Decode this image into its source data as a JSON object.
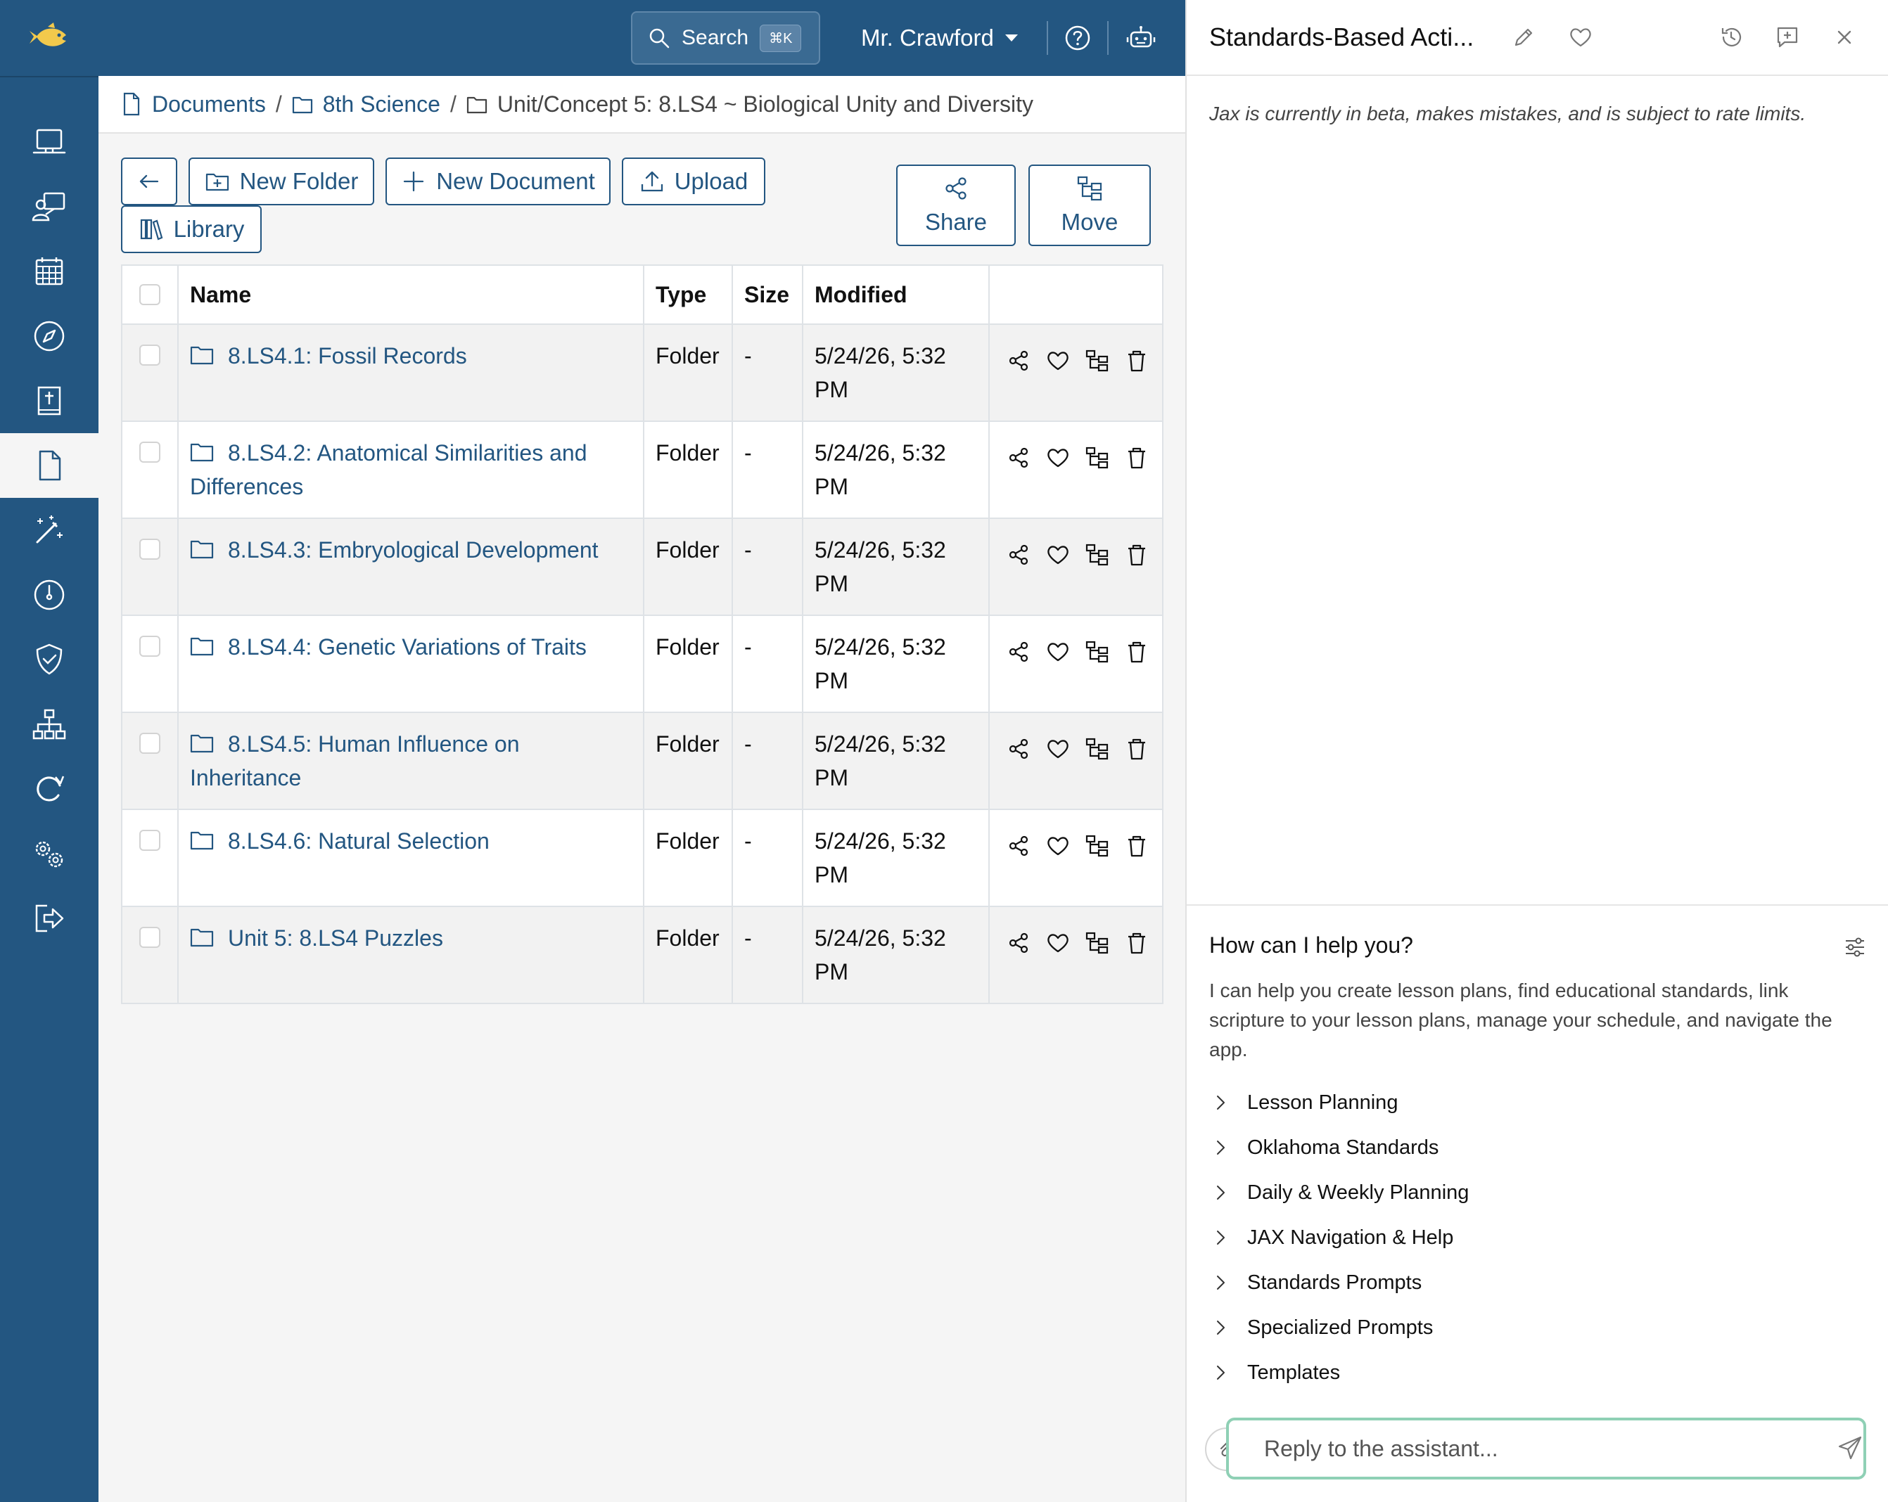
{
  "topbar": {
    "search_label": "Search",
    "search_shortcut": "⌘K",
    "user_name": "Mr. Crawford"
  },
  "sidebar": {
    "items": [
      {
        "icon": "laptop-icon"
      },
      {
        "icon": "teacher-icon"
      },
      {
        "icon": "calendar-icon"
      },
      {
        "icon": "compass-icon"
      },
      {
        "icon": "bible-icon"
      },
      {
        "icon": "document-icon",
        "active": true
      },
      {
        "icon": "magic-wand-icon"
      },
      {
        "icon": "speedometer-icon"
      },
      {
        "icon": "shield-check-icon"
      },
      {
        "icon": "sitemap-icon"
      },
      {
        "icon": "refresh-icon"
      },
      {
        "icon": "gears-icon"
      },
      {
        "icon": "logout-icon"
      }
    ]
  },
  "breadcrumb": {
    "items": [
      "Documents",
      "8th Science"
    ],
    "current": "Unit/Concept 5: 8.LS4 ~ Biological Unity and Diversity",
    "separator": "/"
  },
  "toolbar": {
    "new_folder": "New Folder",
    "new_document": "New Document",
    "upload": "Upload",
    "library": "Library",
    "share": "Share",
    "move": "Move"
  },
  "table": {
    "headers": {
      "name": "Name",
      "type": "Type",
      "size": "Size",
      "modified": "Modified"
    },
    "rows": [
      {
        "name": "8.LS4.1: Fossil Records",
        "type": "Folder",
        "size": "-",
        "modified": "5/24/26, 5:32 PM"
      },
      {
        "name": "8.LS4.2: Anatomical Similarities and Differences",
        "type": "Folder",
        "size": "-",
        "modified": "5/24/26, 5:32 PM"
      },
      {
        "name": "8.LS4.3: Embryological Development",
        "type": "Folder",
        "size": "-",
        "modified": "5/24/26, 5:32 PM"
      },
      {
        "name": "8.LS4.4: Genetic Variations of Traits",
        "type": "Folder",
        "size": "-",
        "modified": "5/24/26, 5:32 PM"
      },
      {
        "name": "8.LS4.5: Human Influence on Inheritance",
        "type": "Folder",
        "size": "-",
        "modified": "5/24/26, 5:32 PM"
      },
      {
        "name": "8.LS4.6: Natural Selection",
        "type": "Folder",
        "size": "-",
        "modified": "5/24/26, 5:32 PM"
      },
      {
        "name": "Unit 5: 8.LS4 Puzzles",
        "type": "Folder",
        "size": "-",
        "modified": "5/24/26, 5:32 PM"
      }
    ]
  },
  "panel": {
    "title": "Standards-Based Acti...",
    "beta_note": "Jax is currently in beta, makes mistakes, and is subject to rate limits.",
    "help_title": "How can I help you?",
    "help_desc": "I can help you create lesson plans, find educational standards, link scripture to your lesson plans, manage your schedule, and navigate the app.",
    "prompts": [
      "Lesson Planning",
      "Oklahoma Standards",
      "Daily & Weekly Planning",
      "JAX Navigation & Help",
      "Standards Prompts",
      "Specialized Prompts",
      "Templates"
    ],
    "reply_placeholder": "Reply to the assistant..."
  },
  "colors": {
    "brand": "#235681",
    "logo": "#f2c94c",
    "reply_border": "#8fd0b5"
  }
}
